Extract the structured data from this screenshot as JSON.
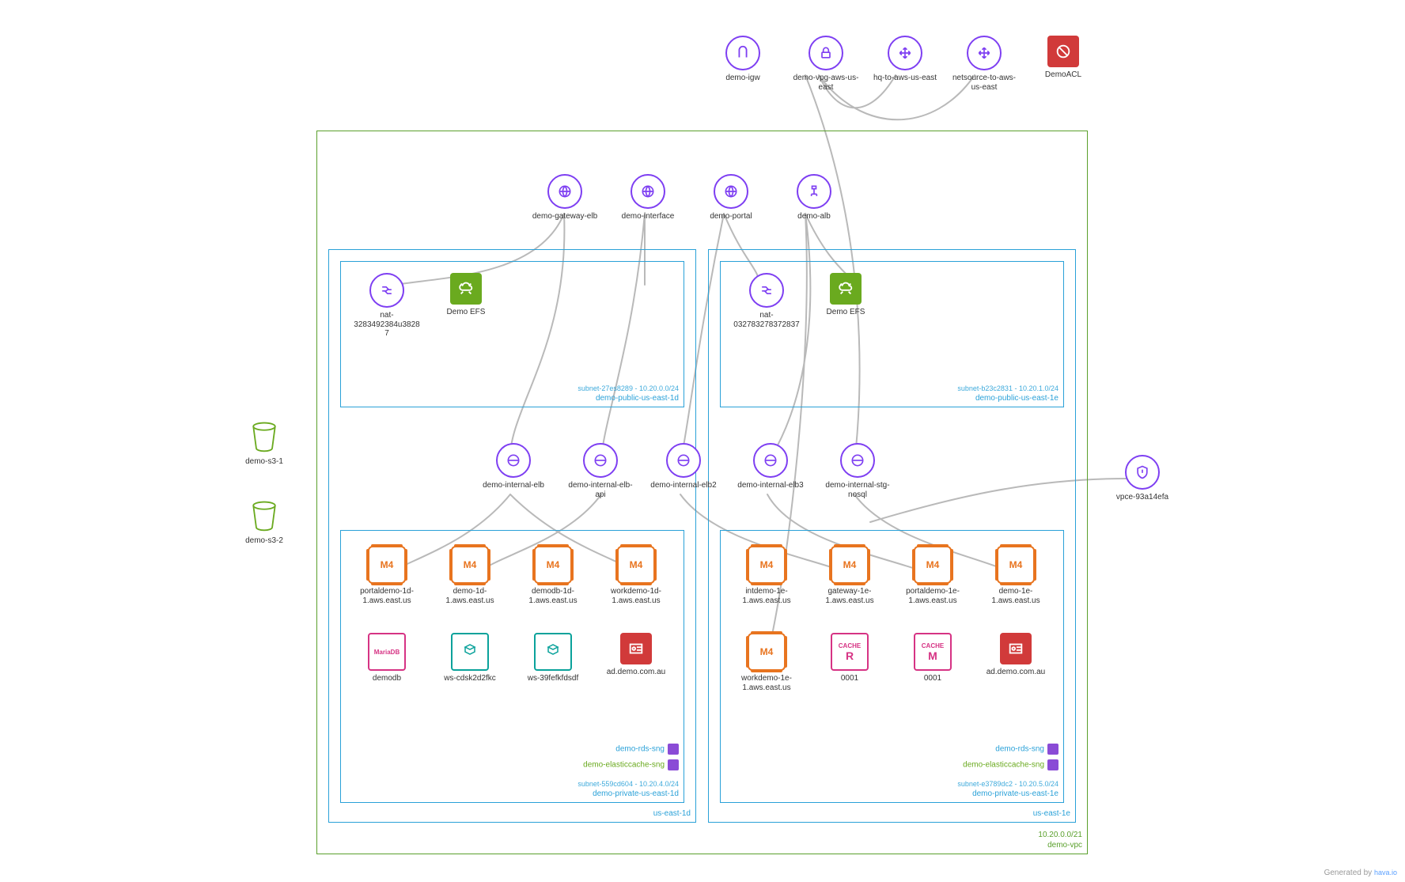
{
  "footer": {
    "text": "Generated by",
    "brand": "hava.io"
  },
  "vpc": {
    "name": "demo-vpc",
    "cidr": "10.20.0.0/21"
  },
  "az1": {
    "name": "us-east-1d"
  },
  "az2": {
    "name": "us-east-1e"
  },
  "subnet_pub1": {
    "name": "demo-public-us-east-1d",
    "id": "subnet-27es8289",
    "cidr": "10.20.0.0/24"
  },
  "subnet_pub2": {
    "name": "demo-public-us-east-1e",
    "id": "subnet-b23c2831",
    "cidr": "10.20.1.0/24"
  },
  "subnet_prv1": {
    "name": "demo-private-us-east-1d",
    "id": "subnet-559cd604",
    "cidr": "10.20.4.0/24"
  },
  "subnet_prv2": {
    "name": "demo-private-us-east-1e",
    "id": "subnet-e3789dc2",
    "cidr": "10.20.5.0/24"
  },
  "sng": {
    "rds": "demo-rds-sng",
    "cache": "demo-elasticcache-sng"
  },
  "external": {
    "igw": "demo-igw",
    "vpg": "demo-vpg-aws-us-east",
    "vpn1": "hq-to-aws-us-east",
    "vpn2": "netsource-to-aws-us-east",
    "acl": "DemoACL",
    "s3a": "demo-s3-1",
    "s3b": "demo-s3-2",
    "vpce": "vpce-93a14efa"
  },
  "elb": {
    "gateway": "demo-gateway-elb",
    "iface": "demo-interface",
    "portal": "demo-portal",
    "alb": "demo-alb",
    "int1": "demo-internal-elb",
    "int_api": "demo-internal-elb-api",
    "int2": "demo-internal-elb2",
    "int3": "demo-internal-elb3",
    "int_stg": "demo-internal-stg-nosql"
  },
  "pub1": {
    "nat": "nat-3283492384u38287",
    "efs": "Demo EFS"
  },
  "pub2": {
    "nat": "nat-032783278372837",
    "efs": "Demo EFS"
  },
  "ec2_1d": {
    "portal": "portaldemo-1d-1.aws.east.us",
    "demo": "demo-1d-1.aws.east.us",
    "demodb": "demodb-1d-1.aws.east.us",
    "work": "workdemo-1d-1.aws.east.us"
  },
  "ec2_1e": {
    "int": "intdemo-1e-1.aws.east.us",
    "gateway": "gateway-1e-1.aws.east.us",
    "portal": "portaldemo-1e-1.aws.east.us",
    "demo": "demo-1e-1.aws.east.us",
    "work": "workdemo-1e-1.aws.east.us"
  },
  "row2": {
    "mariadb": "demodb",
    "ws1": "ws-cdsk2d2fkc",
    "ws2": "ws-39fefkfdsdf",
    "ad1": "ad.demo.com.au",
    "cacheR": "0001",
    "cacheM": "0001",
    "ad2": "ad.demo.com.au"
  },
  "glyphtext": {
    "m4": "M4",
    "maria": "MariaDB",
    "cacheR": "CACHE",
    "cacheR2": "R",
    "cacheM": "CACHE",
    "cacheM2": "M"
  }
}
